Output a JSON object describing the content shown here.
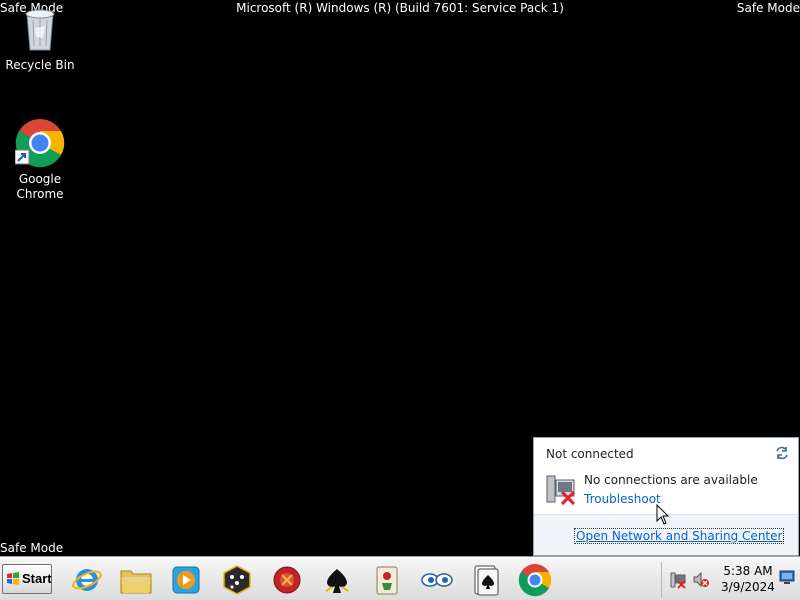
{
  "watermark": {
    "top_left": "Safe Mode",
    "top_center": "Microsoft (R) Windows (R) (Build 7601: Service Pack 1)",
    "top_right": "Safe Mode",
    "bottom_left": "Safe Mode"
  },
  "desktop": {
    "icons": [
      {
        "label": "Recycle Bin",
        "icon": "recycle-bin-icon"
      },
      {
        "label": "Google\nChrome",
        "icon": "chrome-icon"
      }
    ]
  },
  "network_popup": {
    "title": "Not connected",
    "message": "No connections are available",
    "troubleshoot": "Troubleshoot",
    "link": "Open Network and Sharing Center",
    "icons": [
      "refresh-icon",
      "network-disconnected-icon"
    ]
  },
  "taskbar": {
    "start_label": "Start",
    "pinned": [
      {
        "name": "internet-explorer-icon"
      },
      {
        "name": "windows-explorer-icon"
      },
      {
        "name": "media-player-icon"
      },
      {
        "name": "game-dice-icon"
      },
      {
        "name": "game-chess-icon"
      },
      {
        "name": "spider-solitaire-icon"
      },
      {
        "name": "mahjong-icon"
      },
      {
        "name": "eyes-icon"
      },
      {
        "name": "solitaire-icon"
      },
      {
        "name": "chrome-icon"
      }
    ],
    "tray": {
      "icons": [
        "network-disconnected-tray-icon",
        "volume-muted-icon"
      ],
      "time": "5:38 AM",
      "date": "3/9/2024"
    }
  },
  "colors": {
    "desktop_bg": "#000000",
    "link": "#0066cc",
    "error_red": "#e0262a"
  }
}
